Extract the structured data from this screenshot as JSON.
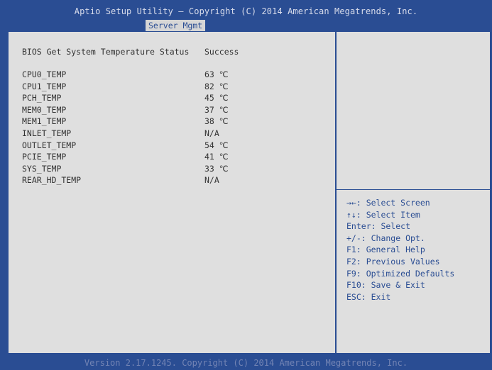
{
  "header": {
    "title": "Aptio Setup Utility – Copyright (C) 2014 American Megatrends, Inc.",
    "active_tab": "Server Mgmt"
  },
  "main": {
    "status": {
      "label": "BIOS Get System Temperature Status",
      "value": "Success"
    },
    "sensors": [
      {
        "name": "CPU0_TEMP",
        "value": "63 ℃"
      },
      {
        "name": "CPU1_TEMP",
        "value": "82 ℃"
      },
      {
        "name": "PCH_TEMP",
        "value": "45 ℃"
      },
      {
        "name": "MEM0_TEMP",
        "value": "37 ℃"
      },
      {
        "name": "MEM1_TEMP",
        "value": "38 ℃"
      },
      {
        "name": "INLET_TEMP",
        "value": "N/A"
      },
      {
        "name": "OUTLET_TEMP",
        "value": "54 ℃"
      },
      {
        "name": "PCIE_TEMP",
        "value": "41 ℃"
      },
      {
        "name": "SYS_TEMP",
        "value": "33 ℃"
      },
      {
        "name": "REAR_HD_TEMP",
        "value": "N/A"
      }
    ]
  },
  "help": {
    "items": [
      "→←: Select Screen",
      "↑↓: Select Item",
      "Enter: Select",
      "+/-: Change Opt.",
      "F1: General Help",
      "F2: Previous Values",
      "F9: Optimized Defaults",
      "F10: Save & Exit",
      "ESC: Exit"
    ]
  },
  "footer": {
    "text": "Version 2.17.1245. Copyright (C) 2014 American Megatrends, Inc."
  },
  "colors": {
    "frame_blue": "#2a4d93",
    "panel_gray": "#dfdfdf",
    "help_text": "#2a4d93",
    "title_text": "#d8dceb"
  }
}
